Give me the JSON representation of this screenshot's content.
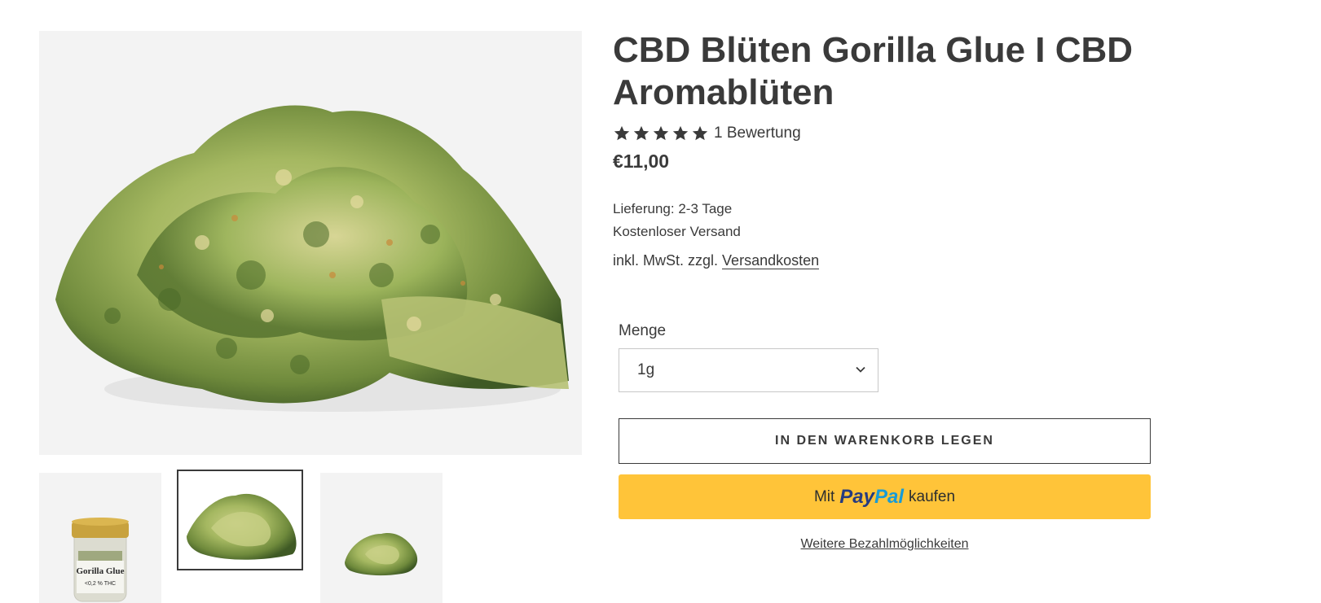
{
  "product": {
    "title": "CBD Blüten Gorilla Glue I CBD Aromablüten",
    "rating": {
      "stars": 5,
      "text": "1 Bewertung"
    },
    "price": "€11,00",
    "delivery": "Lieferung: 2-3 Tage",
    "shipping": "Kostenloser Versand",
    "tax_prefix": "inkl. MwSt. zzgl.",
    "tax_link": "Versandkosten"
  },
  "gallery": {
    "jar_label": "Gorilla Glue",
    "jar_sublabel": "<0,2 % THC",
    "selected_thumb": 2
  },
  "form": {
    "quantity_label": "Menge",
    "quantity_value": "1g",
    "add_to_cart": "IN DEN WARENKORB LEGEN",
    "paypal_prefix": "Mit",
    "paypal_logo_pay": "Pay",
    "paypal_logo_pal": "Pal",
    "paypal_suffix": "kaufen",
    "more_payment": "Weitere Bezahlmöglichkeiten"
  },
  "colors": {
    "text": "#3a3a3a",
    "paypal_yellow": "#ffc439",
    "paypal_dark_blue": "#253b80",
    "paypal_light_blue": "#179bd7"
  }
}
